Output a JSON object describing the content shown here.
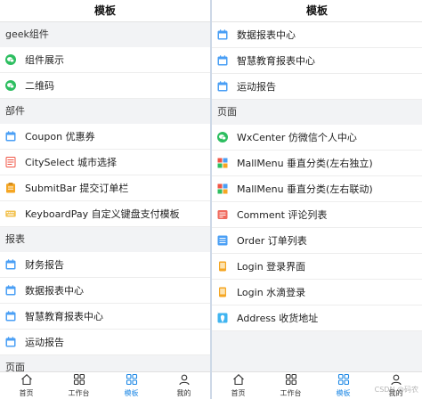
{
  "left": {
    "title": "模板",
    "sections": [
      {
        "label": "geek组件",
        "items": [
          {
            "label": "组件展示",
            "icon": "wechat-icon"
          },
          {
            "label": "二维码",
            "icon": "wechat-icon"
          }
        ]
      },
      {
        "label": "部件",
        "items": [
          {
            "label": "Coupon 优惠券",
            "icon": "calendar-icon"
          },
          {
            "label": "CitySelect 城市选择",
            "icon": "document-red-icon"
          },
          {
            "label": "SubmitBar 提交订单栏",
            "icon": "clipboard-icon"
          },
          {
            "label": "KeyboardPay 自定义键盘支付模板",
            "icon": "keyboard-icon"
          }
        ]
      },
      {
        "label": "报表",
        "items": [
          {
            "label": "财务报告",
            "icon": "calendar-icon"
          },
          {
            "label": "数据报表中心",
            "icon": "calendar-icon"
          },
          {
            "label": "智慧教育报表中心",
            "icon": "calendar-icon"
          },
          {
            "label": "运动报告",
            "icon": "calendar-icon"
          }
        ]
      },
      {
        "label": "页面",
        "items": []
      }
    ],
    "tabs": [
      {
        "label": "首页",
        "icon": "home-icon",
        "active": false
      },
      {
        "label": "工作台",
        "icon": "grid-icon",
        "active": false
      },
      {
        "label": "模板",
        "icon": "grid-icon",
        "active": true
      },
      {
        "label": "我的",
        "icon": "user-icon",
        "active": false
      }
    ]
  },
  "right": {
    "title": "模板",
    "sections": [
      {
        "label": "",
        "items": [
          {
            "label": "数据报表中心",
            "icon": "calendar-icon"
          },
          {
            "label": "智慧教育报表中心",
            "icon": "calendar-icon"
          },
          {
            "label": "运动报告",
            "icon": "calendar-icon"
          }
        ]
      },
      {
        "label": "页面",
        "items": [
          {
            "label": "WxCenter 仿微信个人中心",
            "icon": "wechat-icon"
          },
          {
            "label": "MallMenu 垂直分类(左右独立)",
            "icon": "colorgrid-icon"
          },
          {
            "label": "MallMenu 垂直分类(左右联动)",
            "icon": "colorgrid-icon"
          },
          {
            "label": "Comment 评论列表",
            "icon": "comment-icon"
          },
          {
            "label": "Order 订单列表",
            "icon": "order-icon"
          },
          {
            "label": "Login 登录界面",
            "icon": "login-icon"
          },
          {
            "label": "Login 水滴登录",
            "icon": "login-icon"
          },
          {
            "label": "Address 收货地址",
            "icon": "address-icon"
          }
        ]
      }
    ],
    "tabs": [
      {
        "label": "首页",
        "icon": "home-icon",
        "active": false
      },
      {
        "label": "工作台",
        "icon": "grid-icon",
        "active": false
      },
      {
        "label": "模板",
        "icon": "grid-icon",
        "active": true
      },
      {
        "label": "我的",
        "icon": "user-icon",
        "active": false
      }
    ],
    "watermark": "CSDN @码农"
  },
  "colors": {
    "accent": "#1e88e5",
    "wechat": "#2dbe60",
    "calendar": "#4a9ff5",
    "red": "#f05545",
    "orange": "#f5a623",
    "keyboard": "#f2c14e"
  }
}
